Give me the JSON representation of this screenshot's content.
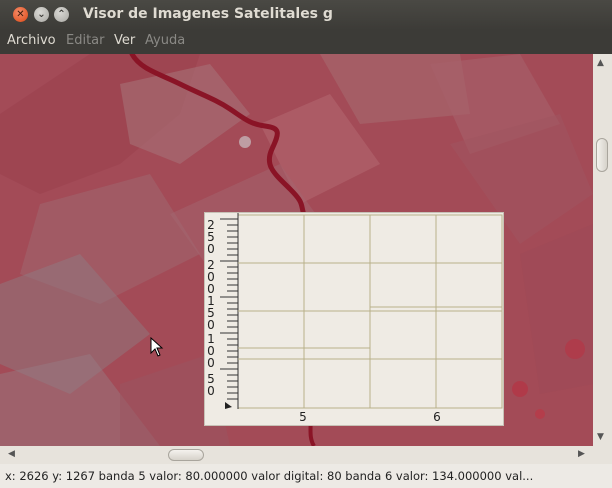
{
  "window": {
    "title": "Visor de Imagenes Satelitales g",
    "buttons": {
      "close_icon": "close-icon",
      "minimize_icon": "minimize-icon",
      "maximize_icon": "maximize-icon"
    }
  },
  "menu": {
    "items": [
      {
        "label": "Archivo",
        "enabled": true
      },
      {
        "label": "Editar",
        "enabled": false
      },
      {
        "label": "Ver",
        "enabled": true
      },
      {
        "label": "Ayuda",
        "enabled": false
      }
    ]
  },
  "scatter_plot": {
    "y_tick_labels": [
      "2",
      "5",
      "0",
      "2",
      "0",
      "0",
      "1",
      "5",
      "0",
      "1",
      "0",
      "0",
      "5",
      "0"
    ],
    "x_tick_labels": [
      "5",
      "6"
    ]
  },
  "scrollbars": {
    "vertical_thumb": "scrollbar-thumb",
    "horizontal_thumb": "scrollbar-thumb"
  },
  "status": {
    "text": "x: 2626 y: 1267 banda 5 valor: 80.000000 valor digital: 80 banda 6 valor: 134.000000 val..."
  },
  "colors": {
    "titlebar": "#3c3b37",
    "close_button": "#dd4814",
    "image_base": "#a34b57",
    "river": "#8a1426",
    "plot_background": "#efebe4",
    "plot_grid": "#b8b08a"
  }
}
